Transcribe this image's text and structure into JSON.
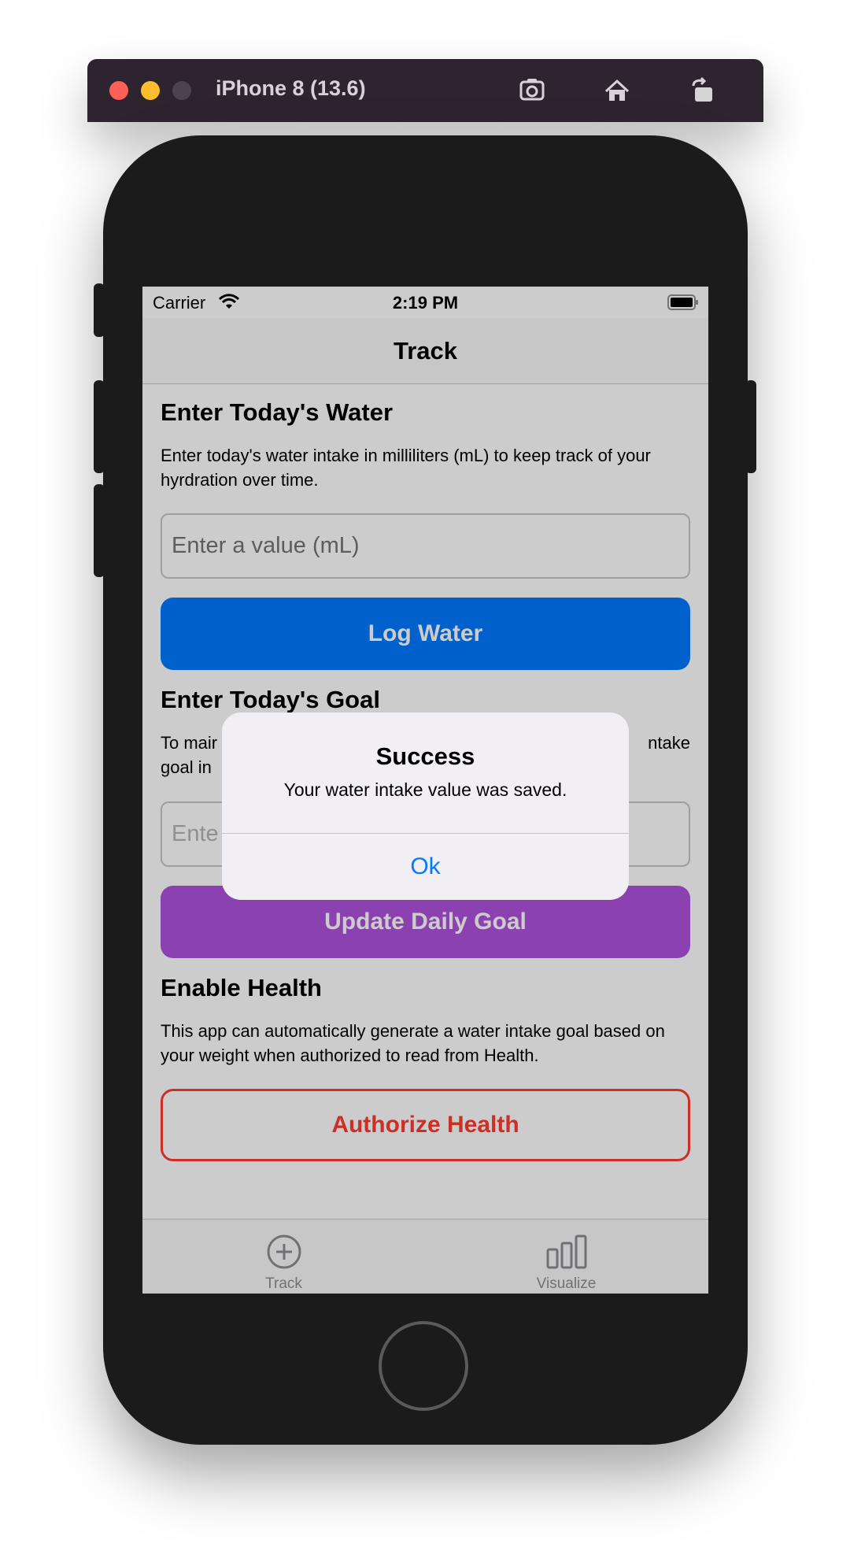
{
  "simulator": {
    "title": "iPhone 8 (13.6)",
    "buttons": [
      "screenshot-icon",
      "home-icon",
      "rotate-icon"
    ]
  },
  "status_bar": {
    "carrier": "Carrier",
    "time": "2:19 PM"
  },
  "nav": {
    "title": "Track"
  },
  "water_section": {
    "heading": "Enter Today's Water",
    "description": "Enter today's water intake in milliliters (mL) to keep track of your hyrdration over time.",
    "input_placeholder": "Enter a value (mL)",
    "button_label": "Log Water"
  },
  "goal_section": {
    "heading": "Enter Today's Goal",
    "description_visible_start": "To mair",
    "description_visible_end": "ntake",
    "description_line2_start": "goal in",
    "input_placeholder_visible": "Ente",
    "button_label": "Update Daily Goal"
  },
  "health_section": {
    "heading": "Enable Health",
    "description": "This app can automatically generate a water intake goal based on your weight when authorized to read from Health.",
    "button_label": "Authorize Health"
  },
  "tab_bar": {
    "tabs": [
      {
        "label": "Track",
        "icon": "plus-circle-icon"
      },
      {
        "label": "Visualize",
        "icon": "bar-chart-icon"
      }
    ]
  },
  "alert": {
    "title": "Success",
    "message": "Your water intake value was saved.",
    "ok_label": "Ok"
  },
  "colors": {
    "blue": "#007aff",
    "purple": "#af52de",
    "red": "#ff3b30"
  }
}
